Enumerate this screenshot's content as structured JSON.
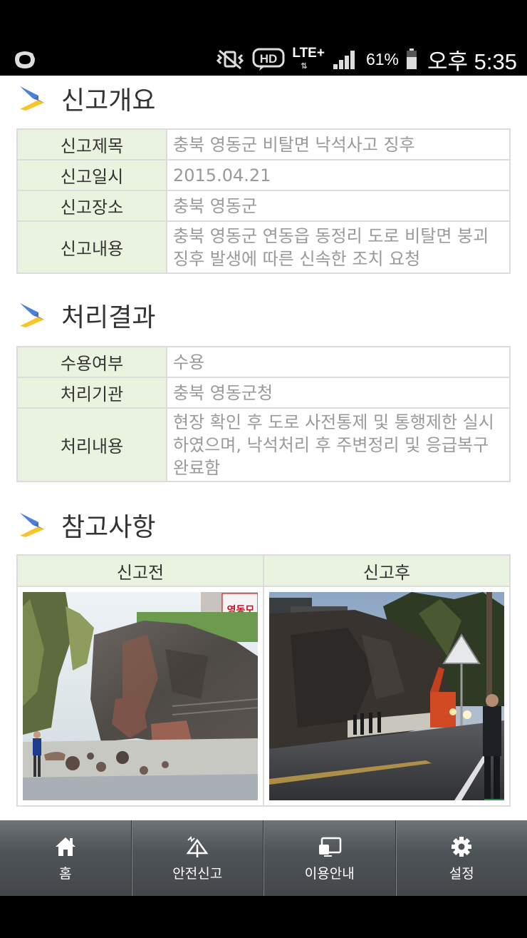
{
  "status_bar": {
    "hd_label": "HD",
    "network": "LTE+",
    "battery_percent": "61%",
    "time": "오후 5:35"
  },
  "report_overview": {
    "title": "신고개요",
    "rows": [
      {
        "key": "신고제목",
        "value": "충북 영동군 비탈면 낙석사고 징후"
      },
      {
        "key": "신고일시",
        "value": "2015.04.21"
      },
      {
        "key": "신고장소",
        "value": "충북 영동군"
      },
      {
        "key": "신고내용",
        "value": "충북 영동군 연동읍 동정리 도로 비탈면 붕괴징후 발생에 따른 신속한 조치 요청"
      }
    ]
  },
  "result": {
    "title": "처리결과",
    "rows": [
      {
        "key": "수용여부",
        "value": "수용"
      },
      {
        "key": "처리기관",
        "value": "충북 영동군청"
      },
      {
        "key": "처리내용",
        "value": "현장 확인 후 도로 사전통제 및 통행제한 실시하였으며, 낙석처리 후 주변정리 및 응급복구 완료함"
      }
    ]
  },
  "reference": {
    "title": "참고사항",
    "before_label": "신고전",
    "after_label": "신고후",
    "sign_text": "영동모"
  },
  "bottom_nav": [
    {
      "label": "홈",
      "icon": "home-icon"
    },
    {
      "label": "안전신고",
      "icon": "safety-report-icon"
    },
    {
      "label": "이용안내",
      "icon": "guide-icon"
    },
    {
      "label": "설정",
      "icon": "settings-icon"
    }
  ],
  "colors": {
    "key_cell_bg": "#e9f3df",
    "chevron_blue": "#4d7fd6",
    "chevron_yellow": "#f5c52a"
  }
}
